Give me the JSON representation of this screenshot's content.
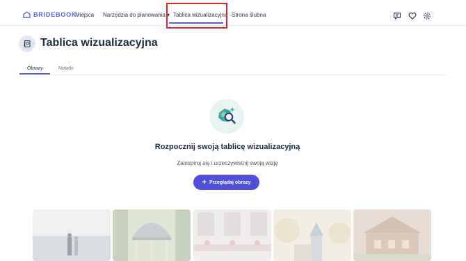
{
  "nav": {
    "logo_text": "BRIDEBOOK",
    "items": [
      {
        "label": "Miejsca"
      },
      {
        "label": "Narzędzia do planowania ▾"
      },
      {
        "label": "Tablica wizualizacyjna"
      },
      {
        "label": "Strona ślubna"
      }
    ],
    "active_index": 2,
    "icons": [
      "chat-icon",
      "heart-icon",
      "settings-icon"
    ]
  },
  "page": {
    "title": "Tablica wizualizacyjna",
    "icon": "moodboard-icon"
  },
  "tabs": [
    {
      "label": "Obrazy"
    },
    {
      "label": "Notatki"
    }
  ],
  "active_tab": 0,
  "empty_state": {
    "title": "Rozpocznij swoją tablicę wizualizacyjną",
    "subtitle": "Zainspiruj się i urzeczywistnij swoją wizję",
    "button_label": "Przeglądaj obrazy",
    "illustration": "magnifier-icon"
  },
  "colors": {
    "accent": "#5b5fdc",
    "button": "#4f4fd8",
    "highlight": "#e0262a",
    "text": "#1f2a44"
  }
}
